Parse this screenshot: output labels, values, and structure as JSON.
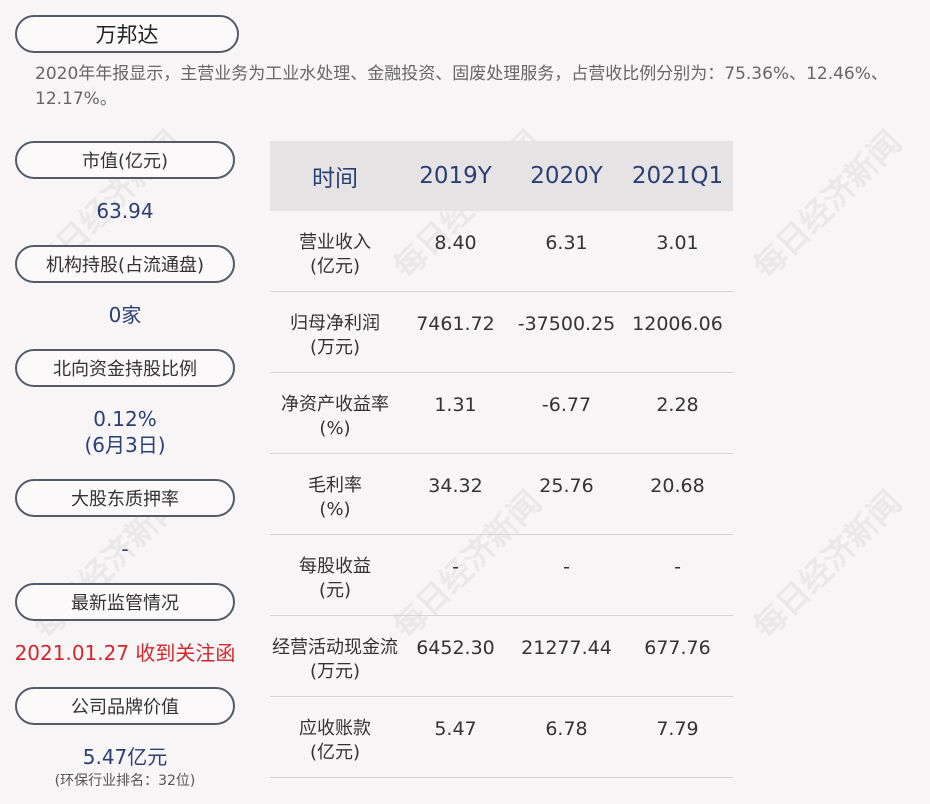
{
  "company": {
    "name": "万邦达"
  },
  "summary": "2020年年报显示，主营业务为工业水处理、金融投资、固废处理服务，占营收比例分别为：75.36%、12.46%、12.17%。",
  "sidebar": {
    "market_cap": {
      "label": "市值(亿元)",
      "value": "63.94"
    },
    "institution": {
      "label": "机构持股(占流通盘)",
      "value": "0家"
    },
    "northbound": {
      "label": "北向资金持股比例",
      "value": "0.12%",
      "date": "(6月3日)"
    },
    "pledge": {
      "label": "大股东质押率",
      "value": "-"
    },
    "regulation": {
      "label": "最新监管情况",
      "value": "2021.01.27 收到关注函"
    },
    "brand": {
      "label": "公司品牌价值",
      "value": "5.47亿元",
      "note": "(环保行业排名：32位)"
    }
  },
  "table": {
    "headers": [
      "时间",
      "2019Y",
      "2020Y",
      "2021Q1"
    ],
    "rows": [
      {
        "label1": "营业收入",
        "label2": "(亿元)",
        "values": [
          "8.40",
          "6.31",
          "3.01"
        ]
      },
      {
        "label1": "归母净利润",
        "label2": "(万元)",
        "values": [
          "7461.72",
          "-37500.25",
          "12006.06"
        ]
      },
      {
        "label1": "净资产收益率",
        "label2": "(%)",
        "values": [
          "1.31",
          "-6.77",
          "2.28"
        ]
      },
      {
        "label1": "毛利率",
        "label2": "(%)",
        "values": [
          "34.32",
          "25.76",
          "20.68"
        ]
      },
      {
        "label1": "每股收益",
        "label2": "(元)",
        "values": [
          "-",
          "-",
          "-"
        ]
      },
      {
        "label1": "经营活动现金流",
        "label2": "(万元)",
        "values": [
          "6452.30",
          "21277.44",
          "677.76"
        ]
      },
      {
        "label1": "应收账款",
        "label2": "(亿元)",
        "values": [
          "5.47",
          "6.78",
          "7.79"
        ]
      }
    ]
  },
  "watermark": "每日经济新闻"
}
